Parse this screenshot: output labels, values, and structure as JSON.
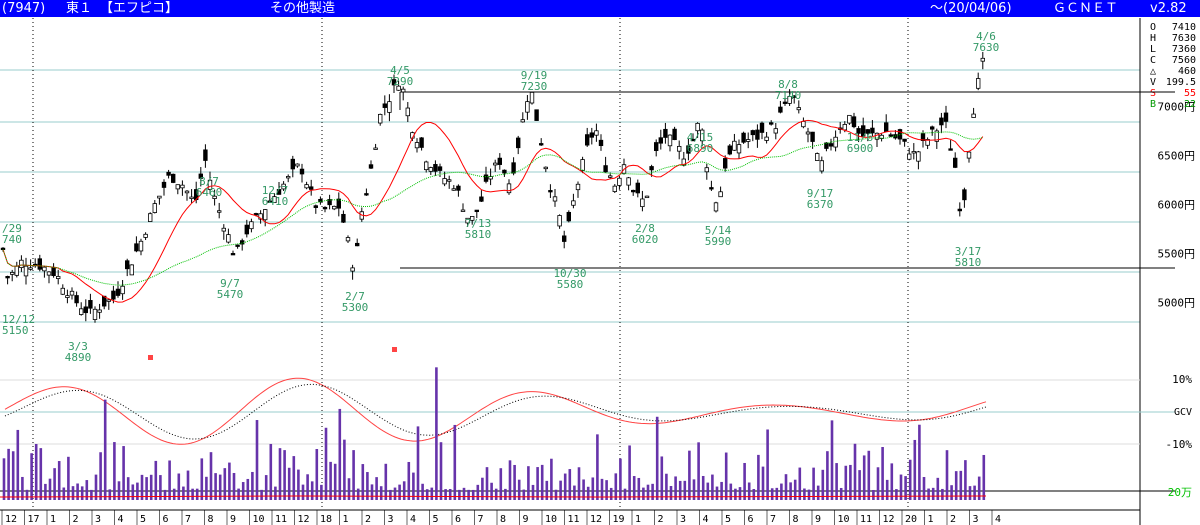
{
  "header": {
    "code": "(7947)",
    "market": "東１",
    "name": "【エフピコ】",
    "sector": "その他製造",
    "date": "～(20/04/06)",
    "brand": "ＧＣＮＥＴ",
    "version": "v2.82"
  },
  "info_panel": {
    "labels": [
      "O",
      "H",
      "L",
      "C",
      "△",
      "V",
      "S",
      "B"
    ],
    "values": [
      "7410",
      "7630",
      "7360",
      "7560",
      "460",
      "199.5",
      "55",
      "22"
    ],
    "colors": [
      "#000000",
      "#000000",
      "#000000",
      "#000000",
      "#000000",
      "#000000",
      "#ff0000",
      "#009900"
    ]
  },
  "colors": {
    "header_bg": "#0000ff",
    "up_candle": "#ffffff",
    "down_candle": "#000000",
    "ma_short": "#ff0000",
    "ma_long": "#00c000",
    "annotation": "#339966",
    "volume_bar": "#6633aa",
    "grid": "#99cccc",
    "osc_fast": "#ff4444",
    "osc_slow": "#000000"
  },
  "chart_data": {
    "type": "candlestick",
    "y_axis": {
      "range": [
        4600,
        7900
      ],
      "ticks": [
        5000,
        5500,
        6000,
        6500,
        7000
      ],
      "tick_labels": [
        "5000円",
        "5500円",
        "6000円",
        "6500円",
        "7000円"
      ]
    },
    "x_labels": [
      "12",
      "17",
      "1",
      "2",
      "3",
      "4",
      "5",
      "6",
      "7",
      "8",
      "9",
      "10",
      "11",
      "12",
      "18",
      "1",
      "2",
      "3",
      "4",
      "5",
      "6",
      "7",
      "8",
      "9",
      "10",
      "11",
      "12",
      "19",
      "1",
      "2",
      "3",
      "4",
      "5",
      "6",
      "7",
      "8",
      "9",
      "10",
      "11",
      "12",
      "20",
      "1",
      "2",
      "3",
      "4"
    ],
    "resistance": 7290,
    "support": 5580,
    "price_path": [
      [
        0,
        5720
      ],
      [
        8,
        5250
      ],
      [
        15,
        5330
      ],
      [
        22,
        5420
      ],
      [
        40,
        5380
      ],
      [
        55,
        5300
      ],
      [
        75,
        5020
      ],
      [
        90,
        4890
      ],
      [
        105,
        5000
      ],
      [
        115,
        5050
      ],
      [
        125,
        5280
      ],
      [
        140,
        5600
      ],
      [
        155,
        6000
      ],
      [
        170,
        6300
      ],
      [
        183,
        6200
      ],
      [
        195,
        6000
      ],
      [
        205,
        6460
      ],
      [
        215,
        6050
      ],
      [
        225,
        5780
      ],
      [
        235,
        5470
      ],
      [
        245,
        5700
      ],
      [
        260,
        5900
      ],
      [
        275,
        6100
      ],
      [
        290,
        6280
      ],
      [
        300,
        6410
      ],
      [
        315,
        6000
      ],
      [
        325,
        5950
      ],
      [
        340,
        5980
      ],
      [
        355,
        5300
      ],
      [
        360,
        5850
      ],
      [
        370,
        6300
      ],
      [
        380,
        6900
      ],
      [
        390,
        7100
      ],
      [
        400,
        7290
      ],
      [
        412,
        6800
      ],
      [
        425,
        6500
      ],
      [
        440,
        6300
      ],
      [
        455,
        6200
      ],
      [
        470,
        5810
      ],
      [
        480,
        6000
      ],
      [
        490,
        6300
      ],
      [
        500,
        6450
      ],
      [
        510,
        6200
      ],
      [
        520,
        6700
      ],
      [
        530,
        7230
      ],
      [
        540,
        6700
      ],
      [
        550,
        6200
      ],
      [
        560,
        5850
      ],
      [
        565,
        5580
      ],
      [
        575,
        6100
      ],
      [
        585,
        6500
      ],
      [
        595,
        6800
      ],
      [
        605,
        6400
      ],
      [
        615,
        6200
      ],
      [
        625,
        6450
      ],
      [
        635,
        6100
      ],
      [
        645,
        6020
      ],
      [
        655,
        6500
      ],
      [
        665,
        6700
      ],
      [
        675,
        6600
      ],
      [
        685,
        6500
      ],
      [
        695,
        6700
      ],
      [
        700,
        6890
      ],
      [
        710,
        6200
      ],
      [
        718,
        5990
      ],
      [
        725,
        6400
      ],
      [
        735,
        6600
      ],
      [
        745,
        6650
      ],
      [
        760,
        6700
      ],
      [
        775,
        6800
      ],
      [
        785,
        7000
      ],
      [
        792,
        7140
      ],
      [
        800,
        6900
      ],
      [
        810,
        6700
      ],
      [
        820,
        6370
      ],
      [
        830,
        6600
      ],
      [
        840,
        6800
      ],
      [
        850,
        6900
      ],
      [
        860,
        6700
      ],
      [
        870,
        6700
      ],
      [
        885,
        6750
      ],
      [
        900,
        6650
      ],
      [
        915,
        6500
      ],
      [
        930,
        6700
      ],
      [
        945,
        6850
      ],
      [
        955,
        6400
      ],
      [
        962,
        5810
      ],
      [
        968,
        6500
      ],
      [
        975,
        7100
      ],
      [
        982,
        7400
      ],
      [
        986,
        7560
      ]
    ],
    "annotations": [
      {
        "date": "/29",
        "value": "740"
      },
      {
        "date": "12/12",
        "value": "5150"
      },
      {
        "date": "3/3",
        "value": "4890"
      },
      {
        "date": "8/7",
        "value": "6460"
      },
      {
        "date": "9/7",
        "value": "5470"
      },
      {
        "date": "12/7",
        "value": "6410"
      },
      {
        "date": "2/7",
        "value": "5300"
      },
      {
        "date": "4/5",
        "value": "7290"
      },
      {
        "date": "7/13",
        "value": "5810"
      },
      {
        "date": "9/19",
        "value": "7230"
      },
      {
        "date": "10/30",
        "value": "5580"
      },
      {
        "date": "2/8",
        "value": "6020"
      },
      {
        "date": "4/15",
        "value": "6890"
      },
      {
        "date": "5/14",
        "value": "5990"
      },
      {
        "date": "8/8",
        "value": "7140"
      },
      {
        "date": "9/17",
        "value": "6370"
      },
      {
        "date": "11/6",
        "value": "6900"
      },
      {
        "date": "3/17",
        "value": "5810"
      },
      {
        "date": "4/6",
        "value": "7630"
      }
    ],
    "oscillator": {
      "labels": [
        "10%",
        "GCV",
        "-10%"
      ]
    },
    "volume": {
      "label": "20万"
    }
  }
}
